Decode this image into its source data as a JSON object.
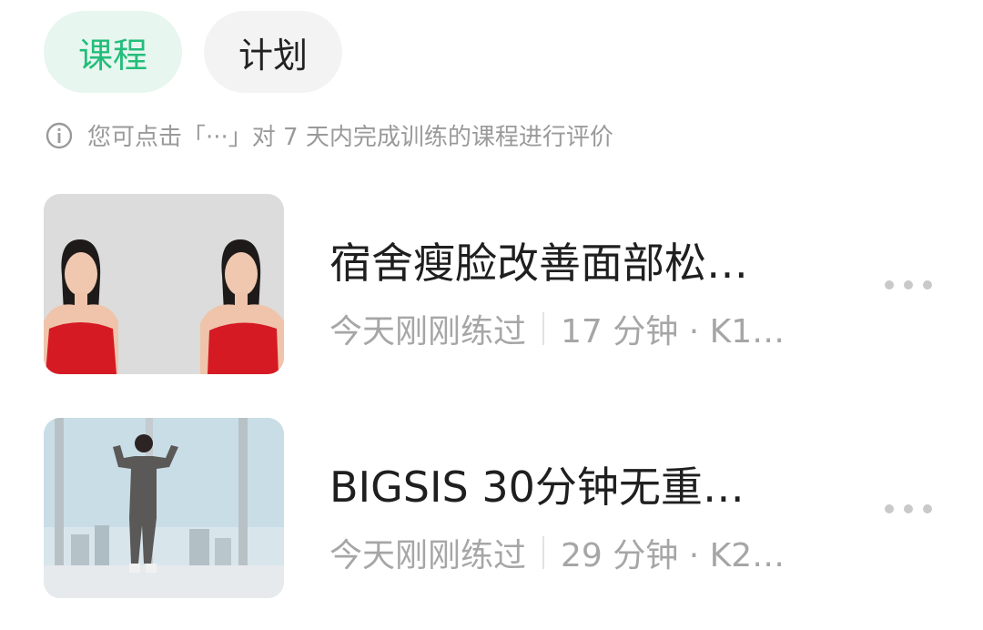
{
  "tabs": [
    {
      "label": "课程",
      "active": true
    },
    {
      "label": "计划",
      "active": false
    }
  ],
  "hint": {
    "icon": "info-icon",
    "text": "您可点击「···」对 7 天内完成训练的课程进行评价"
  },
  "courses": [
    {
      "title": "宿舍瘦脸改善面部松…",
      "status": "今天刚刚练过",
      "details": "17 分钟 · K1…",
      "thumbnail": "face-slimming-thumbnail"
    },
    {
      "title": "BIGSIS 30分钟无重…",
      "status": "今天刚刚练过",
      "details": "29 分钟 · K2…",
      "thumbnail": "workout-thumbnail"
    }
  ],
  "colors": {
    "accent": "#23bd7a",
    "accent_bg": "#e7f6ef",
    "inactive_bg": "#f3f3f3",
    "muted_text": "#a6a6a6"
  }
}
